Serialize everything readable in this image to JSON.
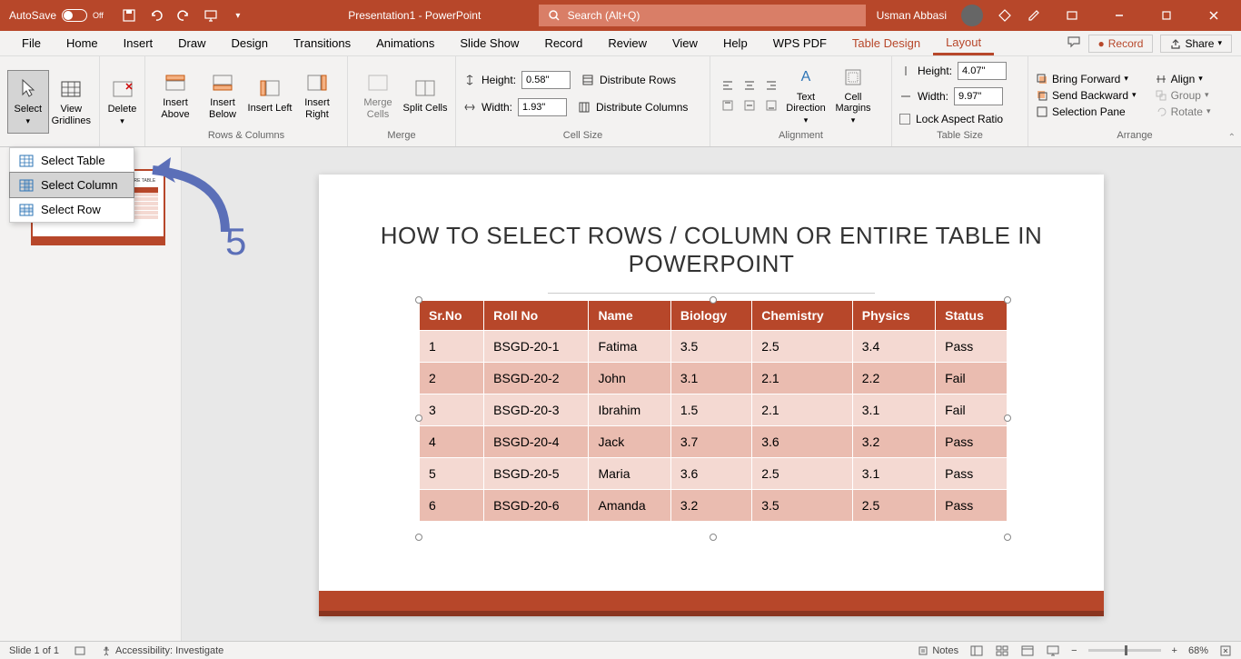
{
  "titlebar": {
    "autosave_label": "AutoSave",
    "autosave_state": "Off",
    "document_title": "Presentation1 - PowerPoint",
    "search_placeholder": "Search (Alt+Q)",
    "user_name": "Usman Abbasi"
  },
  "menubar": {
    "items": [
      "File",
      "Home",
      "Insert",
      "Draw",
      "Design",
      "Transitions",
      "Animations",
      "Slide Show",
      "Record",
      "Review",
      "View",
      "Help",
      "WPS PDF",
      "Table Design",
      "Layout"
    ],
    "record_label": "Record",
    "share_label": "Share"
  },
  "ribbon": {
    "select": {
      "label": "Select",
      "menu": [
        "Select Table",
        "Select Column",
        "Select Row"
      ]
    },
    "view_gridlines": "View Gridlines",
    "delete": "Delete",
    "insert_above": "Insert Above",
    "insert_below": "Insert Below",
    "insert_left": "Insert Left",
    "insert_right": "Insert Right",
    "merge_cells": "Merge Cells",
    "split_cells": "Split Cells",
    "groups": {
      "rows_columns": "Rows & Columns",
      "merge": "Merge",
      "cell_size": "Cell Size",
      "alignment": "Alignment",
      "table_size": "Table Size",
      "arrange": "Arrange"
    },
    "cell_height_label": "Height:",
    "cell_height_value": "0.58\"",
    "cell_width_label": "Width:",
    "cell_width_value": "1.93\"",
    "distribute_rows": "Distribute Rows",
    "distribute_columns": "Distribute Columns",
    "text_direction": "Text Direction",
    "cell_margins": "Cell Margins",
    "table_height_label": "Height:",
    "table_height_value": "4.07\"",
    "table_width_label": "Width:",
    "table_width_value": "9.97\"",
    "lock_aspect": "Lock Aspect Ratio",
    "bring_forward": "Bring Forward",
    "send_backward": "Send Backward",
    "selection_pane": "Selection Pane",
    "align": "Align",
    "group": "Group",
    "rotate": "Rotate"
  },
  "annotation": {
    "number": "5"
  },
  "slide": {
    "title": "HOW TO SELECT ROWS / COLUMN OR ENTIRE TABLE IN POWERPOINT",
    "table": {
      "headers": [
        "Sr.No",
        "Roll No",
        "Name",
        "Biology",
        "Chemistry",
        "Physics",
        "Status"
      ],
      "rows": [
        [
          "1",
          "BSGD-20-1",
          "Fatima",
          "3.5",
          "2.5",
          "3.4",
          "Pass"
        ],
        [
          "2",
          "BSGD-20-2",
          "John",
          "3.1",
          "2.1",
          "2.2",
          "Fail"
        ],
        [
          "3",
          "BSGD-20-3",
          "Ibrahim",
          "1.5",
          "2.1",
          "3.1",
          "Fail"
        ],
        [
          "4",
          "BSGD-20-4",
          "Jack",
          "3.7",
          "3.6",
          "3.2",
          "Pass"
        ],
        [
          "5",
          "BSGD-20-5",
          "Maria",
          "3.6",
          "2.5",
          "3.1",
          "Pass"
        ],
        [
          "6",
          "BSGD-20-6",
          "Amanda",
          "3.2",
          "3.5",
          "2.5",
          "Pass"
        ]
      ]
    }
  },
  "statusbar": {
    "slide_count": "Slide 1 of 1",
    "accessibility": "Accessibility: Investigate",
    "notes": "Notes",
    "zoom": "68%"
  }
}
